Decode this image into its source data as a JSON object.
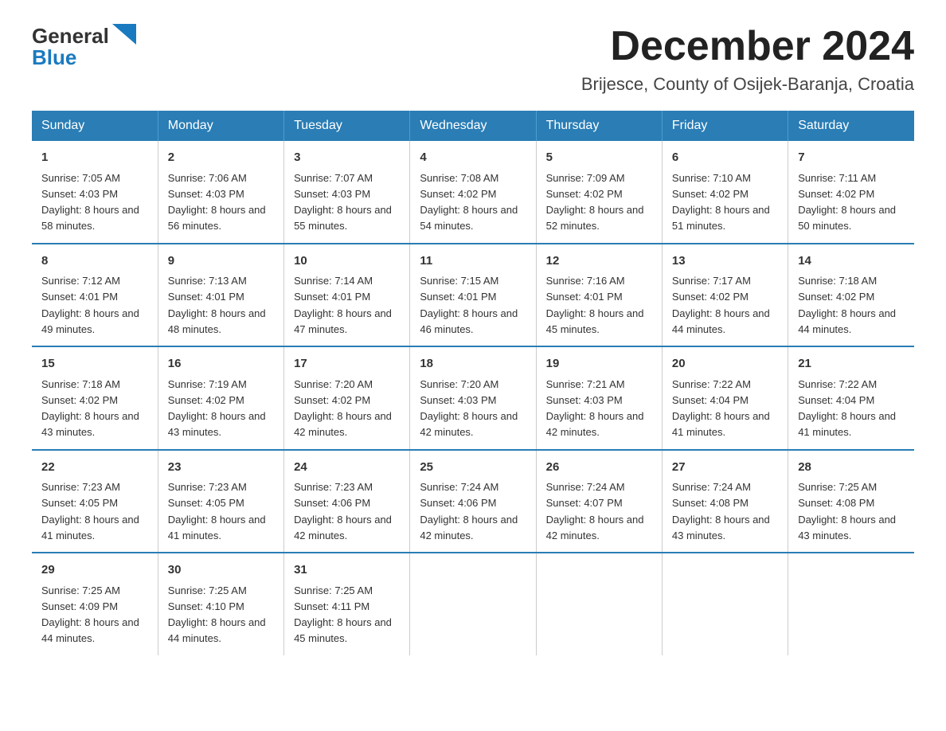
{
  "logo": {
    "general": "General",
    "blue": "Blue",
    "subtitle": "Blue"
  },
  "header": {
    "title": "December 2024",
    "subtitle": "Brijesce, County of Osijek-Baranja, Croatia"
  },
  "days_of_week": [
    "Sunday",
    "Monday",
    "Tuesday",
    "Wednesday",
    "Thursday",
    "Friday",
    "Saturday"
  ],
  "weeks": [
    [
      {
        "day": 1,
        "sunrise": "7:05 AM",
        "sunset": "4:03 PM",
        "daylight": "8 hours and 58 minutes."
      },
      {
        "day": 2,
        "sunrise": "7:06 AM",
        "sunset": "4:03 PM",
        "daylight": "8 hours and 56 minutes."
      },
      {
        "day": 3,
        "sunrise": "7:07 AM",
        "sunset": "4:03 PM",
        "daylight": "8 hours and 55 minutes."
      },
      {
        "day": 4,
        "sunrise": "7:08 AM",
        "sunset": "4:02 PM",
        "daylight": "8 hours and 54 minutes."
      },
      {
        "day": 5,
        "sunrise": "7:09 AM",
        "sunset": "4:02 PM",
        "daylight": "8 hours and 52 minutes."
      },
      {
        "day": 6,
        "sunrise": "7:10 AM",
        "sunset": "4:02 PM",
        "daylight": "8 hours and 51 minutes."
      },
      {
        "day": 7,
        "sunrise": "7:11 AM",
        "sunset": "4:02 PM",
        "daylight": "8 hours and 50 minutes."
      }
    ],
    [
      {
        "day": 8,
        "sunrise": "7:12 AM",
        "sunset": "4:01 PM",
        "daylight": "8 hours and 49 minutes."
      },
      {
        "day": 9,
        "sunrise": "7:13 AM",
        "sunset": "4:01 PM",
        "daylight": "8 hours and 48 minutes."
      },
      {
        "day": 10,
        "sunrise": "7:14 AM",
        "sunset": "4:01 PM",
        "daylight": "8 hours and 47 minutes."
      },
      {
        "day": 11,
        "sunrise": "7:15 AM",
        "sunset": "4:01 PM",
        "daylight": "8 hours and 46 minutes."
      },
      {
        "day": 12,
        "sunrise": "7:16 AM",
        "sunset": "4:01 PM",
        "daylight": "8 hours and 45 minutes."
      },
      {
        "day": 13,
        "sunrise": "7:17 AM",
        "sunset": "4:02 PM",
        "daylight": "8 hours and 44 minutes."
      },
      {
        "day": 14,
        "sunrise": "7:18 AM",
        "sunset": "4:02 PM",
        "daylight": "8 hours and 44 minutes."
      }
    ],
    [
      {
        "day": 15,
        "sunrise": "7:18 AM",
        "sunset": "4:02 PM",
        "daylight": "8 hours and 43 minutes."
      },
      {
        "day": 16,
        "sunrise": "7:19 AM",
        "sunset": "4:02 PM",
        "daylight": "8 hours and 43 minutes."
      },
      {
        "day": 17,
        "sunrise": "7:20 AM",
        "sunset": "4:02 PM",
        "daylight": "8 hours and 42 minutes."
      },
      {
        "day": 18,
        "sunrise": "7:20 AM",
        "sunset": "4:03 PM",
        "daylight": "8 hours and 42 minutes."
      },
      {
        "day": 19,
        "sunrise": "7:21 AM",
        "sunset": "4:03 PM",
        "daylight": "8 hours and 42 minutes."
      },
      {
        "day": 20,
        "sunrise": "7:22 AM",
        "sunset": "4:04 PM",
        "daylight": "8 hours and 41 minutes."
      },
      {
        "day": 21,
        "sunrise": "7:22 AM",
        "sunset": "4:04 PM",
        "daylight": "8 hours and 41 minutes."
      }
    ],
    [
      {
        "day": 22,
        "sunrise": "7:23 AM",
        "sunset": "4:05 PM",
        "daylight": "8 hours and 41 minutes."
      },
      {
        "day": 23,
        "sunrise": "7:23 AM",
        "sunset": "4:05 PM",
        "daylight": "8 hours and 41 minutes."
      },
      {
        "day": 24,
        "sunrise": "7:23 AM",
        "sunset": "4:06 PM",
        "daylight": "8 hours and 42 minutes."
      },
      {
        "day": 25,
        "sunrise": "7:24 AM",
        "sunset": "4:06 PM",
        "daylight": "8 hours and 42 minutes."
      },
      {
        "day": 26,
        "sunrise": "7:24 AM",
        "sunset": "4:07 PM",
        "daylight": "8 hours and 42 minutes."
      },
      {
        "day": 27,
        "sunrise": "7:24 AM",
        "sunset": "4:08 PM",
        "daylight": "8 hours and 43 minutes."
      },
      {
        "day": 28,
        "sunrise": "7:25 AM",
        "sunset": "4:08 PM",
        "daylight": "8 hours and 43 minutes."
      }
    ],
    [
      {
        "day": 29,
        "sunrise": "7:25 AM",
        "sunset": "4:09 PM",
        "daylight": "8 hours and 44 minutes."
      },
      {
        "day": 30,
        "sunrise": "7:25 AM",
        "sunset": "4:10 PM",
        "daylight": "8 hours and 44 minutes."
      },
      {
        "day": 31,
        "sunrise": "7:25 AM",
        "sunset": "4:11 PM",
        "daylight": "8 hours and 45 minutes."
      },
      null,
      null,
      null,
      null
    ]
  ]
}
